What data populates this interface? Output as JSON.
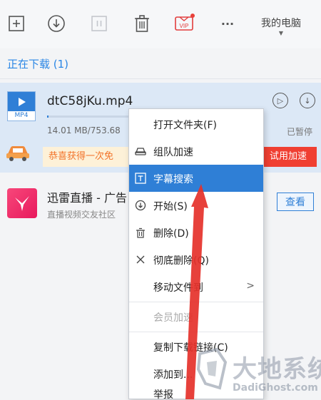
{
  "toolbar": {
    "device_label": "我的电脑",
    "vip_label": "VIP",
    "more_label": "···"
  },
  "section": {
    "title": "正在下载 (1)"
  },
  "download": {
    "file_ext": "MP4",
    "file_name": "dtC58jKu.mp4",
    "size_text": "14.01 MB/753.68",
    "status": "已暂停",
    "progress": 0.02,
    "promo_text": "恭喜获得一次免",
    "trial_button": "试用加速"
  },
  "ad": {
    "title": "迅雷直播 - 广告",
    "subtitle": "直播视频交友社区",
    "view_button": "查看"
  },
  "context_menu": {
    "items": [
      {
        "label": "打开文件夹(F)"
      },
      {
        "label": "组队加速"
      },
      {
        "label": "字幕搜索"
      },
      {
        "label": "开始(S)"
      },
      {
        "label": "删除(D)"
      },
      {
        "label": "彻底删除(Q)"
      },
      {
        "label": "移动文件到",
        "submenu": ">"
      },
      {
        "label": "会员加速"
      },
      {
        "label": "复制下载链接(C)"
      },
      {
        "label": "添加到..."
      },
      {
        "label": "举报"
      }
    ]
  },
  "watermark": {
    "text": "大地系统",
    "sub": "DadiGhost.com"
  },
  "colors": {
    "accent": "#2f7fd6",
    "section_title": "#2a86e5",
    "promo_orange": "#f2742b",
    "trial_red": "#f03f32",
    "arrow_red": "#e5312a"
  }
}
